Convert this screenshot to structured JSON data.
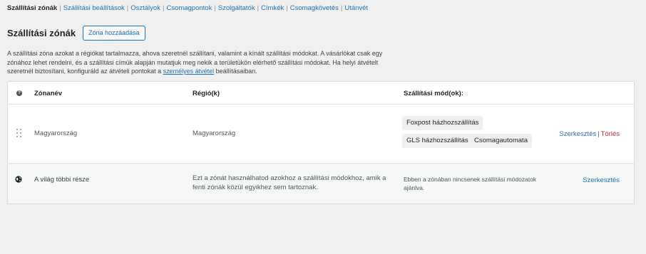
{
  "subnav": {
    "items": [
      {
        "label": "Szállítási zónák",
        "current": true
      },
      {
        "label": "Szállítási beállítások"
      },
      {
        "label": "Osztályok"
      },
      {
        "label": "Csomagpontok"
      },
      {
        "label": "Szolgáltatók"
      },
      {
        "label": "Címkék"
      },
      {
        "label": "Csomagkövetés"
      },
      {
        "label": "Utánvét"
      }
    ]
  },
  "page": {
    "title": "Szállítási zónák",
    "add_button": "Zóna hozzáadása"
  },
  "description": {
    "text": "A szállítási zóna azokat a régiókat tartalmazza, ahova szeretnél szállítani, valamint a kínált szállítási módokat. A vásárlókat csak egy zónához lehet rendelni, és a szállítási címük alapján mutatjuk meg nekik a területükön elérhető szállítási módokat. Ha helyi átvételt szeretnél biztosítani, konfiguráld az átvételi pontokat a ",
    "link": "személyes átvétel",
    "suffix": " beállításaiban."
  },
  "table": {
    "headers": {
      "help": "?",
      "zone_name": "Zónanév",
      "region": "Régió(k)",
      "methods": "Szállítási mód(ok):"
    },
    "zones": [
      {
        "name": "Magyarország",
        "region": "Magyarország",
        "methods": [
          "Foxpost házhozszállítás",
          "GLS házhozszállítás",
          "Csomagautomata"
        ],
        "edit": "Szerkesztés",
        "separator": "|",
        "delete": "Törlés"
      },
      {
        "name": "A világ többi része",
        "region": "Ezt a zónát használhatod azokhoz a szállítási módokhoz, amik a fenti zónák közül egyikhez sem tartoznak.",
        "methods_empty": "Ebben a zónában nincsenek szállítási módozatok ajánlva.",
        "edit": "Szerkesztés"
      }
    ]
  },
  "colors": {
    "link": "#2271b1",
    "delete": "#b32d2e",
    "background": "#f0f0f1"
  }
}
